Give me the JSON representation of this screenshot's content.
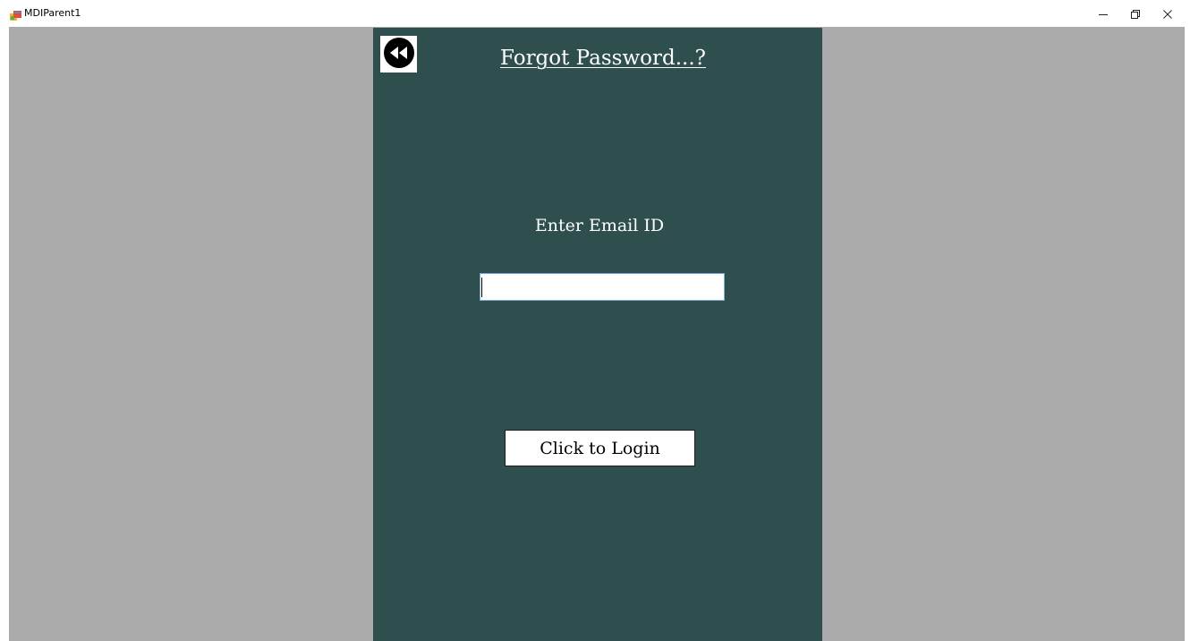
{
  "window": {
    "title": "MDIParent1",
    "controls": {
      "minimize_icon": "minimize-icon",
      "maximize_icon": "restore-icon",
      "close_icon": "close-icon"
    }
  },
  "colors": {
    "mdi_background": "#ababab",
    "form_background": "#2f4f4f",
    "text_light": "#ffffff"
  },
  "form": {
    "title": "Forgot Password...?",
    "back_icon": "rewind-back-icon",
    "email_label": "Enter Email ID",
    "email_input": {
      "value": "",
      "placeholder": ""
    },
    "login_button_label": "Click to Login"
  }
}
